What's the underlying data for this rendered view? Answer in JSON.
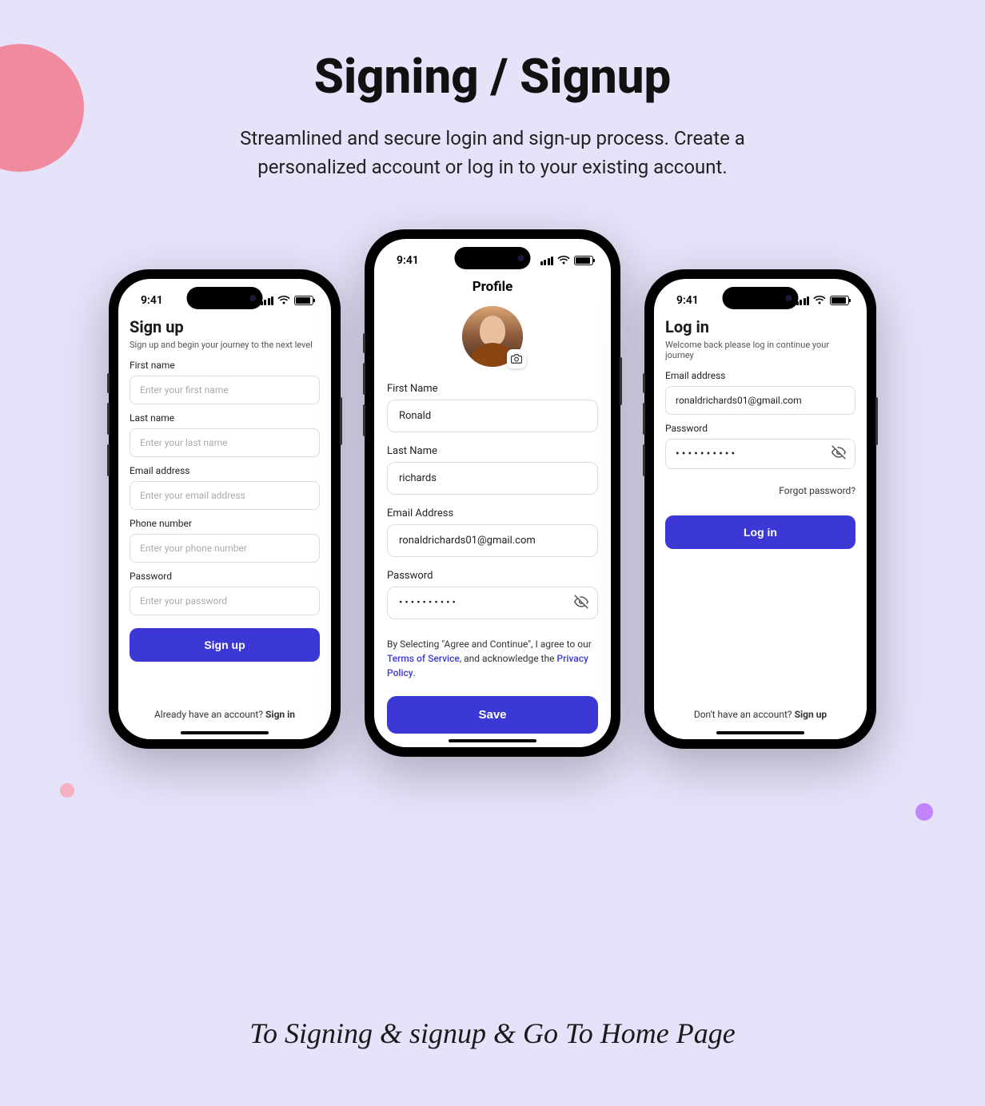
{
  "header": {
    "title": "Signing / Signup",
    "subtitle": "Streamlined and secure login and sign-up process. Create a personalized account or log in to your existing account."
  },
  "status": {
    "time": "9:41"
  },
  "signup": {
    "title": "Sign up",
    "subtitle": "Sign up and begin your journey to the next level",
    "first_name_label": "First name",
    "first_name_placeholder": "Enter your first name",
    "last_name_label": "Last name",
    "last_name_placeholder": "Enter your last name",
    "email_label": "Email address",
    "email_placeholder": "Enter your email address",
    "phone_label": "Phone number",
    "phone_placeholder": "Enter your phone number",
    "password_label": "Password",
    "password_placeholder": "Enter your password",
    "button": "Sign up",
    "footer_prefix": "Already have an account? ",
    "footer_link": "Sign in"
  },
  "profile": {
    "title": "Profile",
    "first_name_label": "First Name",
    "first_name_value": "Ronald",
    "last_name_label": "Last Name",
    "last_name_value": "richards",
    "email_label": "Email Address",
    "email_value": "ronaldrichards01@gmail.com",
    "password_label": "Password",
    "password_value": "••••••••••",
    "terms_prefix": "By Selecting \"Agree and Continue\", I agree to our ",
    "terms_link": "Terms of Service",
    "terms_middle": ", and acknowledge the ",
    "privacy_link": "Privacy Policy",
    "terms_suffix": ".",
    "button": "Save"
  },
  "login": {
    "title": "Log in",
    "subtitle": "Welcome back please log in continue your journey",
    "email_label": "Email address",
    "email_value": "ronaldrichards01@gmail.com",
    "password_label": "Password",
    "password_value": "••••••••••",
    "forgot": "Forgot password?",
    "button": "Log in",
    "footer_prefix": "Don't have an account? ",
    "footer_link": "Sign up"
  },
  "footer": {
    "text": "To Signing & signup & Go To Home Page"
  },
  "colors": {
    "primary": "#3B38D6",
    "bg": "#E5E2F9"
  }
}
